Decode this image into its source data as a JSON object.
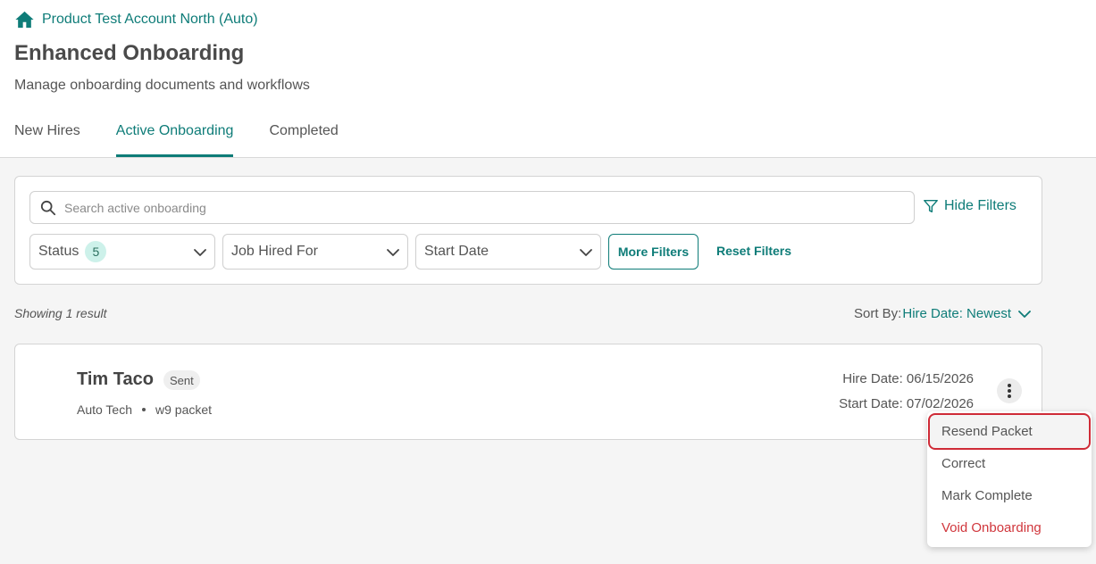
{
  "breadcrumb": {
    "label": "Product Test Account North (Auto)"
  },
  "page": {
    "title": "Enhanced Onboarding",
    "subtitle": "Manage onboarding documents and workflows"
  },
  "tabs": [
    {
      "label": "New Hires",
      "active": false
    },
    {
      "label": "Active Onboarding",
      "active": true
    },
    {
      "label": "Completed",
      "active": false
    }
  ],
  "filters": {
    "search_placeholder": "Search active onboarding",
    "search_value": "",
    "hide_filters_label": "Hide Filters",
    "status": {
      "label": "Status",
      "count": "5"
    },
    "job_hired_for": {
      "label": "Job Hired For"
    },
    "start_date": {
      "label": "Start Date"
    },
    "more_filters_label": "More Filters",
    "reset_filters_label": "Reset Filters"
  },
  "results": {
    "count_text": "Showing 1 result",
    "sort_label": "Sort By:",
    "sort_value": "Hire Date: Newest"
  },
  "card": {
    "name": "Tim Taco",
    "status": "Sent",
    "department": "Auto Tech",
    "packet": "w9 packet",
    "hire_date": "Hire Date: 06/15/2026",
    "start_date": "Start Date: 07/02/2026"
  },
  "menu": {
    "items": [
      {
        "label": "Resend Packet",
        "highlighted": true
      },
      {
        "label": "Correct"
      },
      {
        "label": "Mark Complete"
      },
      {
        "label": "Void Onboarding",
        "danger": true
      }
    ]
  },
  "colors": {
    "accent": "#0e7c78",
    "danger": "#d0363c",
    "highlight_border": "#cf2b37",
    "badge_bg": "#cdf1ea",
    "page_bg": "#f5f5f5"
  },
  "icons": {
    "breadcrumb": "home-icon",
    "search": "search-icon",
    "hide_filters": "filter-icon",
    "select_chevron": "chevron-down-icon",
    "card_actions": "more-vertical-icon"
  }
}
